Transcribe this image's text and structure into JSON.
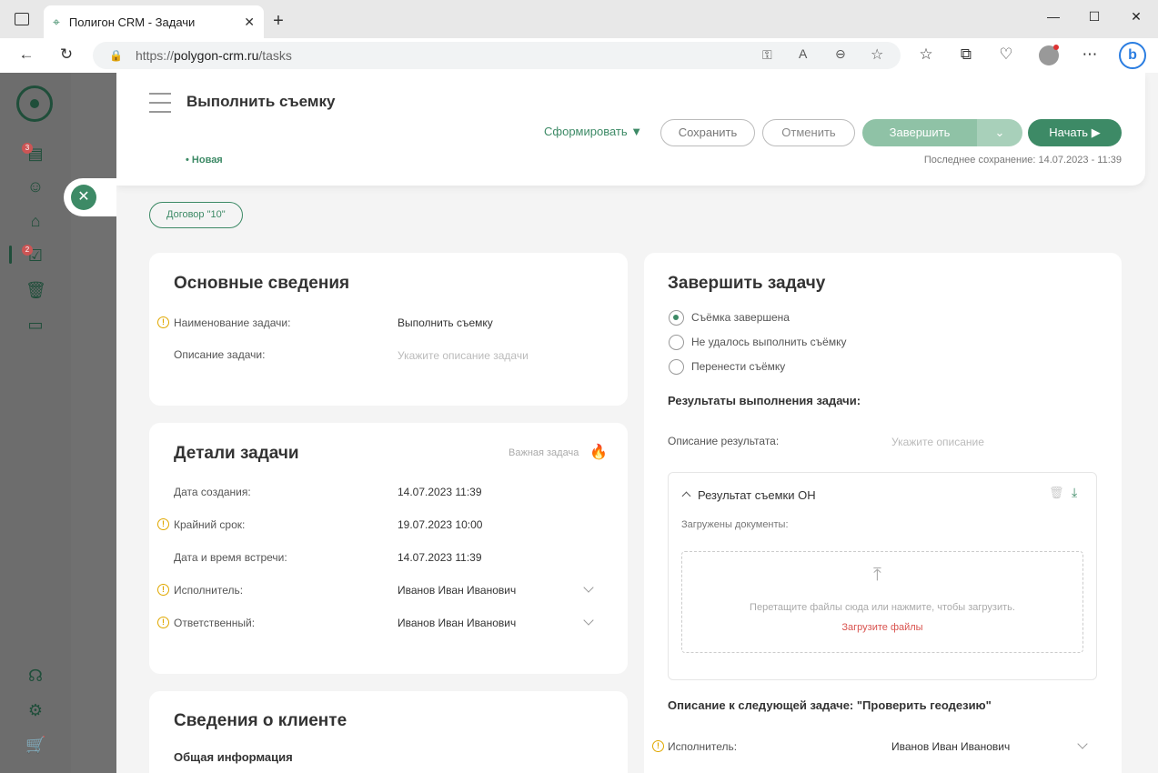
{
  "browser": {
    "tab_title": "Полигон CRM - Задачи",
    "url_scheme": "https://",
    "url_domain": "polygon-crm.ru",
    "url_path": "/tasks"
  },
  "sidebar": {
    "badges": {
      "tasks_doc": "3",
      "tasks_check": "2"
    }
  },
  "header": {
    "title": "Выполнить съемку",
    "status": "• Новая",
    "form_label": "Сформировать",
    "save_label": "Сохранить",
    "cancel_label": "Отменить",
    "finish_label": "Завершить",
    "start_label": "Начать",
    "last_save": "Последнее сохранение: 14.07.2023 - 11:39"
  },
  "contract_tag": "Договор \"10\"",
  "basic_info": {
    "title": "Основные сведения",
    "name_label": "Наименование задачи:",
    "name_value": "Выполнить съемку",
    "desc_label": "Описание задачи:",
    "desc_placeholder": "Укажите описание задачи"
  },
  "details": {
    "title": "Детали задачи",
    "important_label": "Важная задача",
    "created_label": "Дата создания:",
    "created_value": "14.07.2023 11:39",
    "deadline_label": "Крайний срок:",
    "deadline_value": "19.07.2023 10:00",
    "meeting_label": "Дата и время встречи:",
    "meeting_value": "14.07.2023 11:39",
    "executor_label": "Исполнитель:",
    "executor_value": "Иванов Иван Иванович",
    "responsible_label": "Ответственный:",
    "responsible_value": "Иванов Иван Иванович"
  },
  "client": {
    "title": "Сведения о клиенте",
    "general": "Общая информация"
  },
  "complete": {
    "title": "Завершить задачу",
    "options": [
      "Съёмка завершена",
      "Не удалось выполнить съёмку",
      "Перенести съёмку"
    ],
    "selected": 0,
    "results_title": "Результаты выполнения задачи:",
    "result_desc_label": "Описание результата:",
    "result_desc_placeholder": "Укажите описание",
    "result_block_title": "Результат съемки ОН",
    "uploaded_label": "Загружены документы:",
    "drop_text": "Перетащите файлы сюда или нажмите, чтобы загрузить.",
    "upload_link": "Загрузите файлы",
    "next_task_title": "Описание к следующей задаче: \"Проверить геодезию\"",
    "next_executor_label": "Исполнитель:",
    "next_executor_value": "Иванов Иван Иванович"
  },
  "colors": {
    "accent": "#3d8a66",
    "warn": "#e0a800",
    "link_red": "#d9534f"
  }
}
